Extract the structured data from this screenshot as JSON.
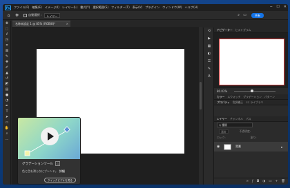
{
  "app": {
    "logo": "Ps"
  },
  "menu": [
    "ファイル(F)",
    "編集(E)",
    "イメージ(I)",
    "レイヤー(L)",
    "書式(Y)",
    "選択範囲(S)",
    "フィルター(T)",
    "表示(V)",
    "プラグイン",
    "ウィンドウ(W)",
    "ヘルプ(H)"
  ],
  "window_controls": [
    "─",
    "☐",
    "✕"
  ],
  "options": {
    "autoselect_label": "自動選択 :",
    "autoselect_value": "レイヤー",
    "share_label": "共有"
  },
  "document": {
    "tab_title": "名称未設定 1 @ 85% (RGB/8)*",
    "close": "×"
  },
  "panels": {
    "top_tabs": [
      "ナビゲーター",
      "ヒストグラム"
    ],
    "zoom": "80.03%",
    "color_tabs": [
      "カラー",
      "スウォッチ",
      "グラデーション",
      "パターン"
    ],
    "prop_tabs": [
      "プロパティ",
      "色調補正",
      "CC ライブラリ"
    ],
    "layer_tabs": [
      "レイヤー",
      "チャンネル",
      "パス"
    ],
    "layers_search_placeholder": "Q 種類",
    "blend_mode": "通常",
    "opacity_label": "不透明度:",
    "lock_label": "ロック:",
    "fill_label": "塗り:",
    "layer_name": "背景"
  },
  "tooltip": {
    "title": "グラデーションツール",
    "shortcut": "G",
    "description": "色と色を滑らかにブレンド。",
    "more_link": "詳細",
    "button": "クイックビデオを見る"
  },
  "colors": {
    "accent": "#1473e6",
    "selection": "#e03a3a"
  }
}
